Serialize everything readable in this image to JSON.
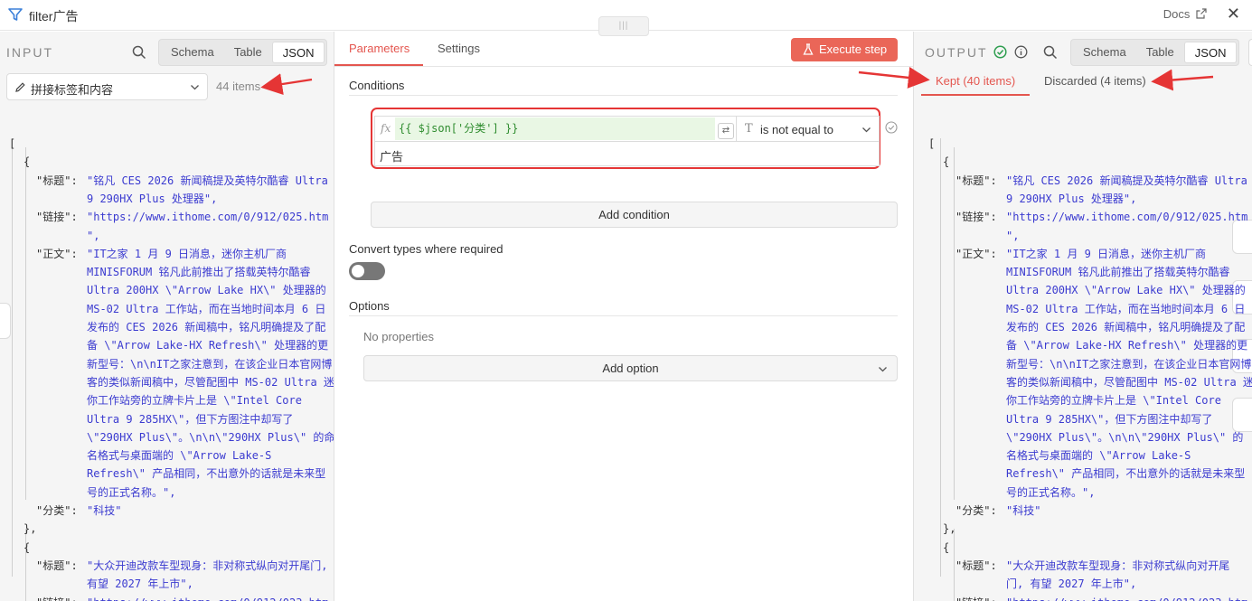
{
  "header": {
    "title": "filter广告",
    "docs": "Docs",
    "close": "✕"
  },
  "input": {
    "pane_title": "INPUT",
    "views": [
      "Schema",
      "Table",
      "JSON"
    ],
    "active_view": "JSON",
    "node_select": "拼接标签和内容",
    "items_count": "44 items"
  },
  "mid": {
    "tabs": [
      "Parameters",
      "Settings"
    ],
    "execute_label": "Execute step",
    "conditions_heading": "Conditions",
    "condition": {
      "fx": "fx",
      "expression": "{{ $json['分类'] }}",
      "operator": "is not equal to",
      "value": "广告"
    },
    "add_condition": "Add condition",
    "convert_types_label": "Convert types where required",
    "convert_types_on": false,
    "options_heading": "Options",
    "no_properties": "No properties",
    "add_option": "Add option"
  },
  "output": {
    "pane_title": "OUTPUT",
    "views": [
      "Schema",
      "Table",
      "JSON"
    ],
    "active_view": "JSON",
    "kept_label": "Kept (40 items)",
    "discarded_label": "Discarded (4 items)"
  },
  "json_lines": [
    {
      "t": "["
    },
    {
      "t": "{"
    },
    {
      "k": "\"标题\":",
      "v": "\"铭凡 CES 2026 新闻稿提及英特尔酷睿 Ultra"
    },
    {
      "v": "9 290HX Plus 处理器\","
    },
    {
      "k": "\"链接\":",
      "v": "\"https://www.ithome.com/0/912/025.htm"
    },
    {
      "v": "\","
    },
    {
      "k": "\"正文\":",
      "v": "\"IT之家 1 月 9 日消息，迷你主机厂商"
    },
    {
      "v": "MINISFORUM 铭凡此前推出了搭载英特尔酷睿"
    },
    {
      "v": "Ultra 200HX \\\"Arrow Lake HX\\\" 处理器的"
    },
    {
      "v": "MS-02 Ultra 工作站，而在当地时间本月 6 日"
    },
    {
      "v": "发布的 CES 2026 新闻稿中，铭凡明确提及了配"
    },
    {
      "v": "备 \\\"Arrow Lake-HX Refresh\\\" 处理器的更"
    },
    {
      "v": "新型号：\\n\\nIT之家注意到，在该企业日本官网博"
    },
    {
      "v": "客的类似新闻稿中，尽管配图中 MS-02 Ultra 迷"
    },
    {
      "v": "你工作站旁的立牌卡片上是 \\\"Intel Core"
    },
    {
      "v": "Ultra 9 285HX\\\"，但下方图注中却写了"
    },
    {
      "v": "\\\"290HX Plus\\\"。\\n\\n\\\"290HX Plus\\\" 的命"
    },
    {
      "v": "名格式与桌面端的 \\\"Arrow Lake-S"
    },
    {
      "v": "Refresh\\\" 产品相同，不出意外的话就是未来型"
    },
    {
      "v": "号的正式名称。\","
    },
    {
      "k": "\"分类\":",
      "v": "\"科技\""
    },
    {
      "t": "},"
    },
    {
      "t": "{"
    },
    {
      "k": "\"标题\":",
      "v": "\"大众开迪改款车型现身：非对称式纵向对开尾门,"
    },
    {
      "v": "有望 2027 年上市\","
    },
    {
      "k": "\"链接\":",
      "v": "\"https://www.ithome.com/0/912/023.htm"
    },
    {
      "v": "\","
    }
  ],
  "json_lines_out": [
    {
      "t": "["
    },
    {
      "t": "{"
    },
    {
      "k": "\"标题\":",
      "v": "\"铭凡 CES 2026 新闻稿提及英特尔酷睿 Ultra"
    },
    {
      "v": "9 290HX Plus 处理器\","
    },
    {
      "k": "\"链接\":",
      "v": "\"https://www.ithome.com/0/912/025.htm"
    },
    {
      "v": "\","
    },
    {
      "k": "\"正文\":",
      "v": "\"IT之家 1 月 9 日消息，迷你主机厂商"
    },
    {
      "v": "MINISFORUM 铭凡此前推出了搭载英特尔酷睿"
    },
    {
      "v": "Ultra 200HX \\\"Arrow Lake HX\\\" 处理器的"
    },
    {
      "v": "MS-02 Ultra 工作站，而在当地时间本月 6 日"
    },
    {
      "v": "发布的 CES 2026 新闻稿中，铭凡明确提及了配"
    },
    {
      "v": "备 \\\"Arrow Lake-HX Refresh\\\" 处理器的更"
    },
    {
      "v": "新型号：\\n\\nIT之家注意到，在该企业日本官网博"
    },
    {
      "v": "客的类似新闻稿中，尽管配图中 MS-02 Ultra 迷"
    },
    {
      "v": "你工作站旁的立牌卡片上是 \\\"Intel Core"
    },
    {
      "v": "Ultra 9 285HX\\\"，但下方图注中却写了"
    },
    {
      "v": "\\\"290HX Plus\\\"。\\n\\n\\\"290HX Plus\\\" 的"
    },
    {
      "v": "名格式与桌面端的 \\\"Arrow Lake-S"
    },
    {
      "v": "Refresh\\\" 产品相同，不出意外的话就是未来型"
    },
    {
      "v": "号的正式名称。\","
    },
    {
      "k": "\"分类\":",
      "v": "\"科技\""
    },
    {
      "t": "},"
    },
    {
      "t": "{"
    },
    {
      "k": "\"标题\":",
      "v": "\"大众开迪改款车型现身：非对称式纵向对开尾"
    },
    {
      "v": "门, 有望 2027 年上市\","
    },
    {
      "k": "\"链接\":",
      "v": "\"https://www.ithome.com/0/912/023.htm"
    },
    {
      "v": "\","
    }
  ],
  "colors": {
    "accent": "#e4564f",
    "string": "#3b3bd0",
    "expr_bg": "#e9f7e4",
    "highlight_box": "#e53535",
    "success": "#2e9e4f"
  }
}
